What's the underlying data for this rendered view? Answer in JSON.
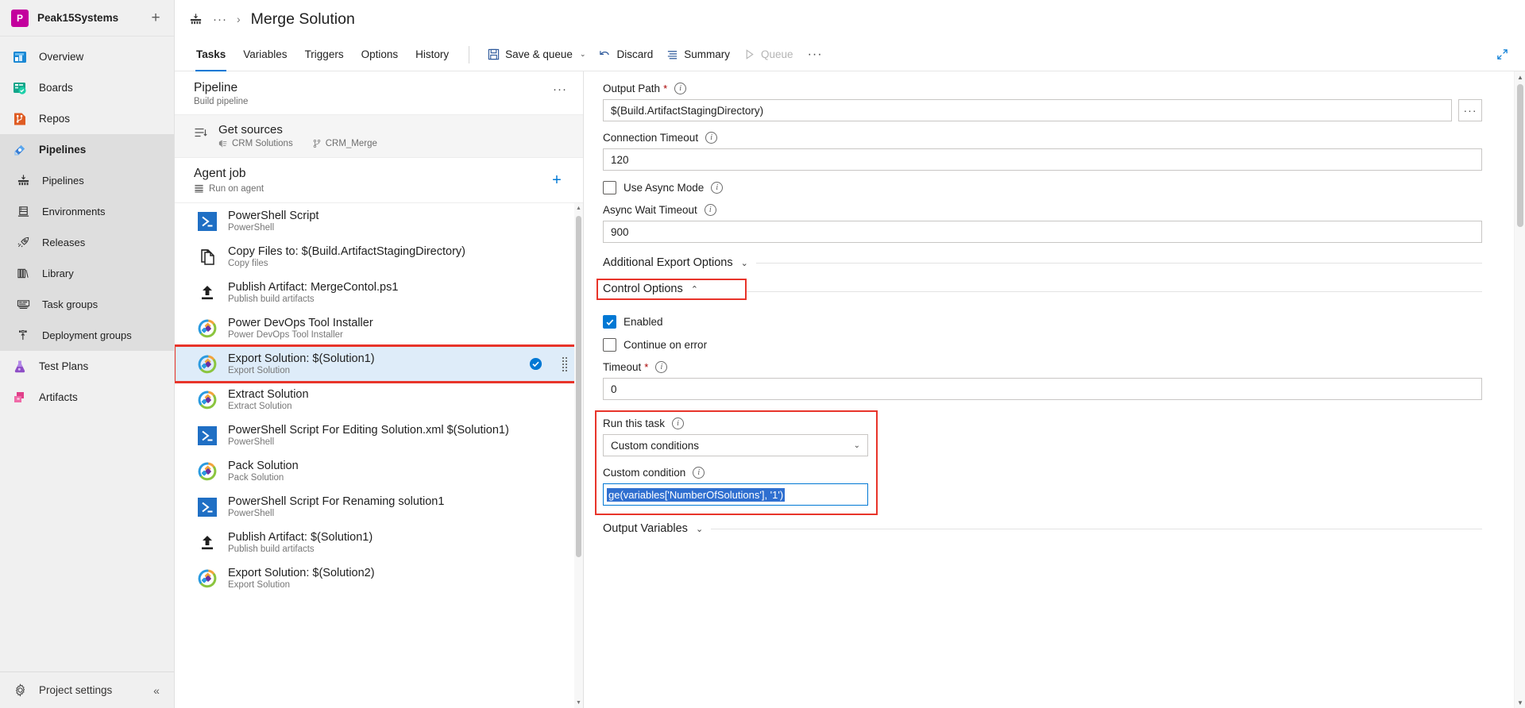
{
  "sidebar": {
    "org": {
      "initial": "P",
      "name": "Peak15Systems",
      "add_label": "+"
    },
    "items": [
      {
        "label": "Overview",
        "icon": "overview-icon"
      },
      {
        "label": "Boards",
        "icon": "boards-icon"
      },
      {
        "label": "Repos",
        "icon": "repos-icon"
      },
      {
        "label": "Pipelines",
        "icon": "pipelines-icon"
      },
      {
        "label": "Pipelines",
        "icon": "pipelines-sub-icon"
      },
      {
        "label": "Environments",
        "icon": "environments-icon"
      },
      {
        "label": "Releases",
        "icon": "releases-icon"
      },
      {
        "label": "Library",
        "icon": "library-icon"
      },
      {
        "label": "Task groups",
        "icon": "task-groups-icon"
      },
      {
        "label": "Deployment groups",
        "icon": "deployment-groups-icon"
      },
      {
        "label": "Test Plans",
        "icon": "test-plans-icon"
      },
      {
        "label": "Artifacts",
        "icon": "artifacts-icon"
      }
    ],
    "project_settings": {
      "label": "Project settings",
      "icon": "gear-icon"
    },
    "collapse": "«"
  },
  "breadcrumb": {
    "pipeline_icon": "build-pipeline-icon",
    "ellipsis": "···",
    "separator": "›",
    "title": "Merge Solution"
  },
  "toolbar": {
    "tabs": [
      {
        "label": "Tasks",
        "selected": true
      },
      {
        "label": "Variables",
        "selected": false
      },
      {
        "label": "Triggers",
        "selected": false
      },
      {
        "label": "Options",
        "selected": false
      },
      {
        "label": "History",
        "selected": false
      }
    ],
    "save_queue": {
      "label": "Save & queue",
      "icon": "save-icon",
      "caret": "⌄"
    },
    "discard": {
      "label": "Discard",
      "icon": "undo-icon"
    },
    "summary": {
      "label": "Summary",
      "icon": "list-icon"
    },
    "queue": {
      "label": "Queue",
      "icon": "play-icon",
      "disabled": true
    },
    "more": "···",
    "expand": "expand-icon"
  },
  "pipeline_panel": {
    "header": {
      "title": "Pipeline",
      "subtitle": "Build pipeline",
      "more": "···"
    },
    "get_sources": {
      "title": "Get sources",
      "repo": "CRM Solutions",
      "branch": "CRM_Merge",
      "icon": "get-sources-icon",
      "repo_icon": "repo-icon",
      "branch_icon": "branch-icon"
    },
    "agent_job": {
      "title": "Agent job",
      "subtitle": "Run on agent",
      "icon": "agent-icon",
      "add": "+"
    },
    "tasks": [
      {
        "title": "PowerShell Script",
        "subtitle": "PowerShell",
        "icon": "powershell-icon",
        "selected": false
      },
      {
        "title": "Copy Files to: $(Build.ArtifactStagingDirectory)",
        "subtitle": "Copy files",
        "icon": "copy-files-icon",
        "selected": false
      },
      {
        "title": "Publish Artifact: MergeContol.ps1",
        "subtitle": "Publish build artifacts",
        "icon": "publish-icon",
        "selected": false
      },
      {
        "title": "Power DevOps Tool Installer",
        "subtitle": "Power DevOps Tool Installer",
        "icon": "power-devops-icon",
        "selected": false
      },
      {
        "title": "Export Solution: $(Solution1)",
        "subtitle": "Export Solution",
        "icon": "power-devops-icon",
        "selected": true,
        "check": "checkmark-icon",
        "grip": "drag-handle-icon"
      },
      {
        "title": "Extract Solution",
        "subtitle": "Extract Solution",
        "icon": "power-devops-icon",
        "selected": false
      },
      {
        "title": "PowerShell Script For Editing Solution.xml $(Solution1)",
        "subtitle": "PowerShell",
        "icon": "powershell-icon",
        "selected": false
      },
      {
        "title": "Pack Solution",
        "subtitle": "Pack Solution",
        "icon": "power-devops-icon",
        "selected": false
      },
      {
        "title": "PowerShell Script For Renaming solution1",
        "subtitle": "PowerShell",
        "icon": "powershell-icon",
        "selected": false
      },
      {
        "title": "Publish Artifact: $(Solution1)",
        "subtitle": "Publish build artifacts",
        "icon": "publish-icon",
        "selected": false
      },
      {
        "title": "Export Solution: $(Solution2)",
        "subtitle": "Export Solution",
        "icon": "power-devops-icon",
        "selected": false
      }
    ]
  },
  "properties": {
    "output_path": {
      "label": "Output Path",
      "required": "*",
      "value": "$(Build.ArtifactStagingDirectory)",
      "browse": "···"
    },
    "connection_timeout": {
      "label": "Connection Timeout",
      "value": "120"
    },
    "use_async_mode": {
      "label": "Use Async Mode",
      "checked": false
    },
    "async_wait_timeout": {
      "label": "Async Wait Timeout",
      "value": "900"
    },
    "additional_export_options": {
      "label": "Additional Export Options",
      "caret": "⌄"
    },
    "control_options": {
      "label": "Control Options",
      "caret": "⌃"
    },
    "enabled": {
      "label": "Enabled",
      "checked": true
    },
    "continue_on_error": {
      "label": "Continue on error",
      "checked": false
    },
    "timeout": {
      "label": "Timeout",
      "required": "*",
      "value": "0"
    },
    "run_this_task": {
      "label": "Run this task",
      "value": "Custom conditions",
      "caret": "⌄"
    },
    "custom_condition": {
      "label": "Custom condition",
      "value": "ge(variables['NumberOfSolutions'], '1')"
    },
    "output_variables": {
      "label": "Output Variables",
      "caret": "⌄"
    }
  },
  "colors": {
    "accent": "#0078d4",
    "highlight_red": "#e8342a",
    "selection_blue": "#2f6fd0",
    "row_selected": "#deecf9",
    "brand_magenta": "#c3009d"
  }
}
